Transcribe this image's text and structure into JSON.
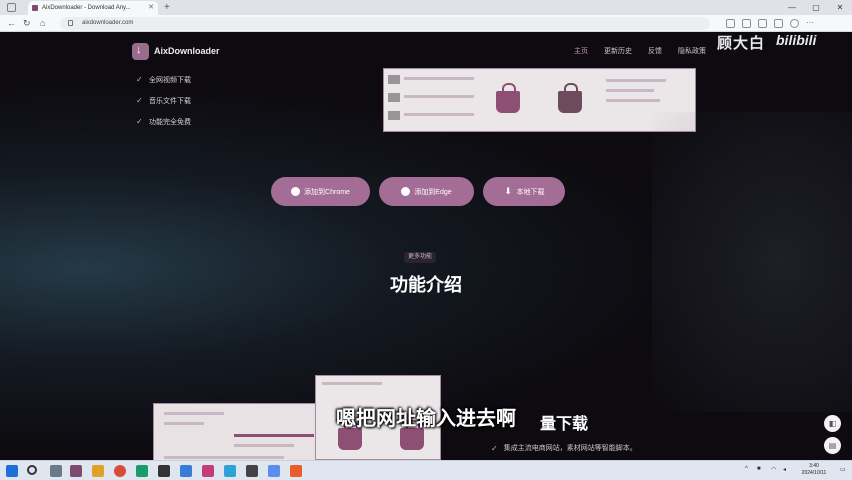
{
  "browser": {
    "tab_title": "AixDownloader - Download Any...",
    "url": "aixdownloader.com",
    "colors": {
      "accent": "#a36d95"
    }
  },
  "site": {
    "logo_text": "AixDownloader",
    "nav": [
      "主页",
      "更新历史",
      "反馈",
      "隐私政策"
    ],
    "features": [
      "全网视频下载",
      "音乐文件下载",
      "功能完全免费"
    ],
    "buttons": {
      "chrome": "添加到Chrome",
      "edge": "添加到Edge",
      "local": "本地下载"
    },
    "section_pill": "更多功能",
    "section_title": "功能介绍",
    "feature_title": "量下载",
    "feature_desc": "集成主流电商网站，素材网站等智能脚本。"
  },
  "overlay": {
    "watermark": "顾大白",
    "bili": "bilibili",
    "subtitle": "嗯把网址输入进去啊"
  },
  "taskbar": {
    "time": "3:40",
    "date": "2024/10/11"
  }
}
